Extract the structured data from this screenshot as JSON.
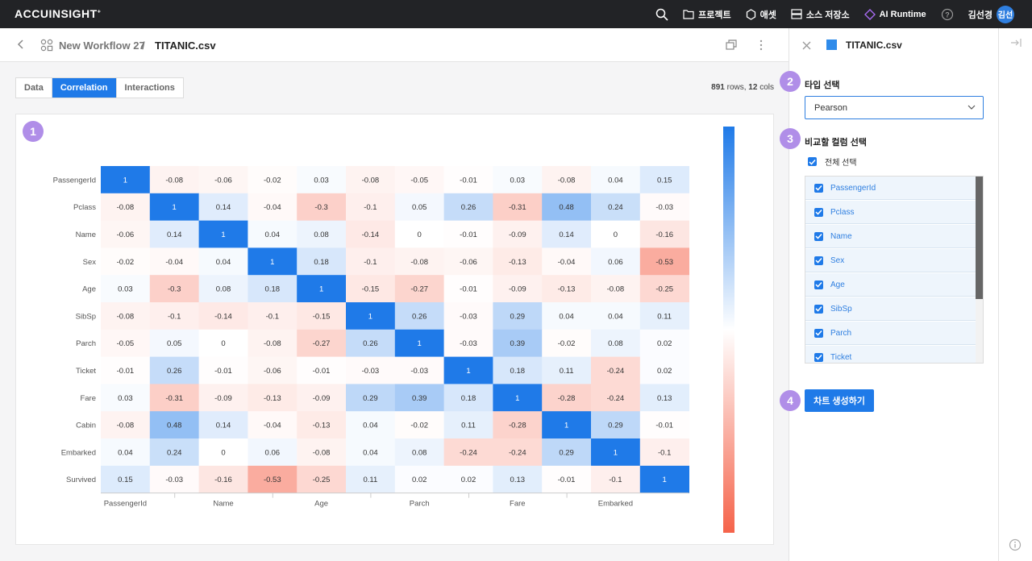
{
  "topbar": {
    "logo": "ACCUINSIGHT",
    "logo_mark": "+",
    "nav": {
      "project": "프로젝트",
      "asset": "애셋",
      "source_store": "소스 저장소",
      "ai_runtime": "AI Runtime"
    },
    "user_name": "김선경",
    "avatar_text": "김선"
  },
  "breadcrumb": {
    "workflow": "New Workflow 27",
    "separator": "/",
    "file": "TITANIC.csv"
  },
  "tabs": [
    "Data",
    "Correlation",
    "Interactions"
  ],
  "active_tab": "Correlation",
  "rowcount": {
    "rows": "891",
    "rows_label": "rows,",
    "cols": "12",
    "cols_label": "cols"
  },
  "badges": [
    "1",
    "2",
    "3",
    "4"
  ],
  "panel": {
    "title": "TITANIC.csv",
    "type_label": "타입 선택",
    "type_value": "Pearson",
    "columns_label": "비교할 컬럼 선택",
    "select_all": "전체 선택",
    "columns": [
      "PassengerId",
      "Pclass",
      "Name",
      "Sex",
      "Age",
      "SibSp",
      "Parch",
      "Ticket"
    ],
    "create_button": "차트 생성하기"
  },
  "colors": {
    "accent": "#1f7ae8",
    "badge": "#b08ee8",
    "heat_positive": "#1f7ae8",
    "heat_zero": "#ffffff",
    "heat_negative": "#f5634a"
  },
  "chart_data": {
    "type": "heatmap",
    "labels": [
      "PassengerId",
      "Pclass",
      "Name",
      "Sex",
      "Age",
      "SibSp",
      "Parch",
      "Ticket",
      "Fare",
      "Cabin",
      "Embarked",
      "Survived"
    ],
    "x_tick_labels": [
      "PassengerId",
      "Name",
      "Age",
      "Parch",
      "Fare",
      "Embarked"
    ],
    "values": [
      [
        1,
        -0.08,
        -0.06,
        -0.02,
        0.03,
        -0.08,
        -0.05,
        -0.01,
        0.03,
        -0.08,
        0.04,
        0.15
      ],
      [
        -0.08,
        1,
        0.14,
        -0.04,
        -0.3,
        -0.1,
        0.05,
        0.26,
        -0.31,
        0.48,
        0.24,
        -0.03
      ],
      [
        -0.06,
        0.14,
        1,
        0.04,
        0.08,
        -0.14,
        0,
        -0.01,
        -0.09,
        0.14,
        0,
        -0.16
      ],
      [
        -0.02,
        -0.04,
        0.04,
        1,
        0.18,
        -0.1,
        -0.08,
        -0.06,
        -0.13,
        -0.04,
        0.06,
        -0.53
      ],
      [
        0.03,
        -0.3,
        0.08,
        0.18,
        1,
        -0.15,
        -0.27,
        -0.01,
        -0.09,
        -0.13,
        -0.08,
        -0.25
      ],
      [
        -0.08,
        -0.1,
        -0.14,
        -0.1,
        -0.15,
        1,
        0.26,
        -0.03,
        0.29,
        0.04,
        0.04,
        0.11
      ],
      [
        -0.05,
        0.05,
        0,
        -0.08,
        -0.27,
        0.26,
        1,
        -0.03,
        0.39,
        -0.02,
        0.08,
        0.02
      ],
      [
        -0.01,
        0.26,
        -0.01,
        -0.06,
        -0.01,
        -0.03,
        -0.03,
        1,
        0.18,
        0.11,
        -0.24,
        0.02
      ],
      [
        0.03,
        -0.31,
        -0.09,
        -0.13,
        -0.09,
        0.29,
        0.39,
        0.18,
        1,
        -0.28,
        -0.24,
        0.13
      ],
      [
        -0.08,
        0.48,
        0.14,
        -0.04,
        -0.13,
        0.04,
        -0.02,
        0.11,
        -0.28,
        1,
        0.29,
        -0.01
      ],
      [
        0.04,
        0.24,
        0,
        0.06,
        -0.08,
        0.04,
        0.08,
        -0.24,
        -0.24,
        0.29,
        1,
        -0.1
      ],
      [
        0.15,
        -0.03,
        -0.16,
        -0.53,
        -0.25,
        0.11,
        0.02,
        0.02,
        0.13,
        -0.01,
        -0.1,
        1
      ]
    ],
    "color_range": [
      -1,
      1
    ],
    "legend": "right"
  }
}
